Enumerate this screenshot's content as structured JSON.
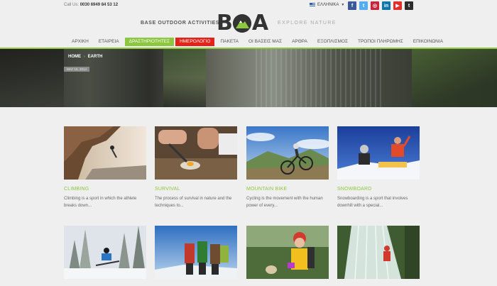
{
  "topbar": {
    "call_label": "Call Us:",
    "phone": "0030 6949 84 53 12",
    "language": "ΕΛΛΗΝΙΚΑ",
    "socials": [
      {
        "name": "facebook-icon",
        "glyph": "f",
        "color": "#3b5998"
      },
      {
        "name": "twitter-icon",
        "glyph": "t",
        "color": "#55acee"
      },
      {
        "name": "instagram-icon",
        "glyph": "◎",
        "color": "#c8233c"
      },
      {
        "name": "linkedin-icon",
        "glyph": "in",
        "color": "#0e76a8"
      },
      {
        "name": "youtube-icon",
        "glyph": "▶",
        "color": "#e52d27"
      },
      {
        "name": "tumblr-icon",
        "glyph": "t",
        "color": "#2c2c2c"
      }
    ]
  },
  "header": {
    "tagline": "BASE OUTDOOR ACTIVITIES",
    "logo": "BOA",
    "explore": "EXPLORE NATURE"
  },
  "nav": {
    "items": [
      {
        "label": "ΑΡΧΙΚΗ",
        "style": ""
      },
      {
        "label": "ΕΤΑΙΡΕΙΑ",
        "style": ""
      },
      {
        "label": "ΔΡΑΣΤΗΡΙΟΤΗΤΕΣ",
        "style": "green"
      },
      {
        "label": "ΗΜΕΡΟΛΟΓΙΟ",
        "style": "red"
      },
      {
        "label": "ΠΑΚΕΤΑ",
        "style": ""
      },
      {
        "label": "ΟΙ ΒΑΣΕΙΣ ΜΑΣ",
        "style": ""
      },
      {
        "label": "ΑΡΘΡΑ",
        "style": ""
      },
      {
        "label": "ΕΞΟΠΛΙΣΜΟΣ",
        "style": ""
      },
      {
        "label": "ΤΡΟΠΟΙ ΠΛΗΡΩΜΗΣ",
        "style": ""
      },
      {
        "label": "ΕΠΙΚΟΙΝΩΝΙΑ",
        "style": ""
      }
    ]
  },
  "hero": {
    "breadcrumb_home": "HOME",
    "breadcrumb_sep": "›",
    "breadcrumb_current": "EARTH",
    "date": "MAY 19, 2014"
  },
  "cards": [
    {
      "title": "CLIMBING",
      "desc": "Climbing is a sport in which the athlete breaks down..."
    },
    {
      "title": "SURVIVAL",
      "desc": "The process of survival in nature and the techniques to..."
    },
    {
      "title": "MOUNTAIN BIKE",
      "desc": "Cycling is the movement with the human power of every..."
    },
    {
      "title": "SNOWBOARD",
      "desc": "Snowboarding is a sport that involves downhill with a special..."
    }
  ],
  "colors": {
    "accent": "#8dc63f",
    "red": "#e3221a"
  }
}
